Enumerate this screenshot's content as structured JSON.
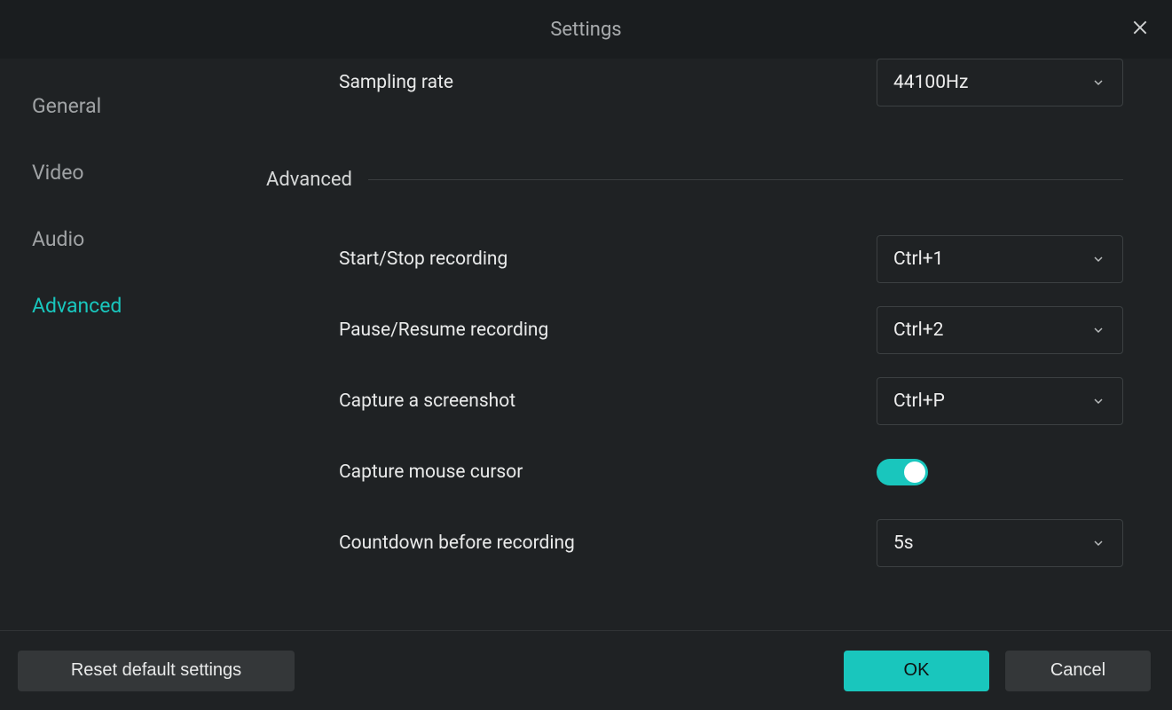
{
  "title": "Settings",
  "sidebar": {
    "items": [
      {
        "label": "General"
      },
      {
        "label": "Video"
      },
      {
        "label": "Audio"
      },
      {
        "label": "Advanced"
      }
    ],
    "activeIndex": 3
  },
  "content": {
    "sampling_rate_label": "Sampling rate",
    "sampling_rate_value": "44100Hz",
    "section_header": "Advanced",
    "start_stop_label": "Start/Stop recording",
    "start_stop_value": "Ctrl+1",
    "pause_resume_label": "Pause/Resume recording",
    "pause_resume_value": "Ctrl+2",
    "capture_screenshot_label": "Capture a screenshot",
    "capture_screenshot_value": "Ctrl+P",
    "capture_cursor_label": "Capture mouse cursor",
    "capture_cursor_on": true,
    "countdown_label": "Countdown before recording",
    "countdown_value": "5s"
  },
  "footer": {
    "reset_label": "Reset default settings",
    "ok_label": "OK",
    "cancel_label": "Cancel"
  }
}
